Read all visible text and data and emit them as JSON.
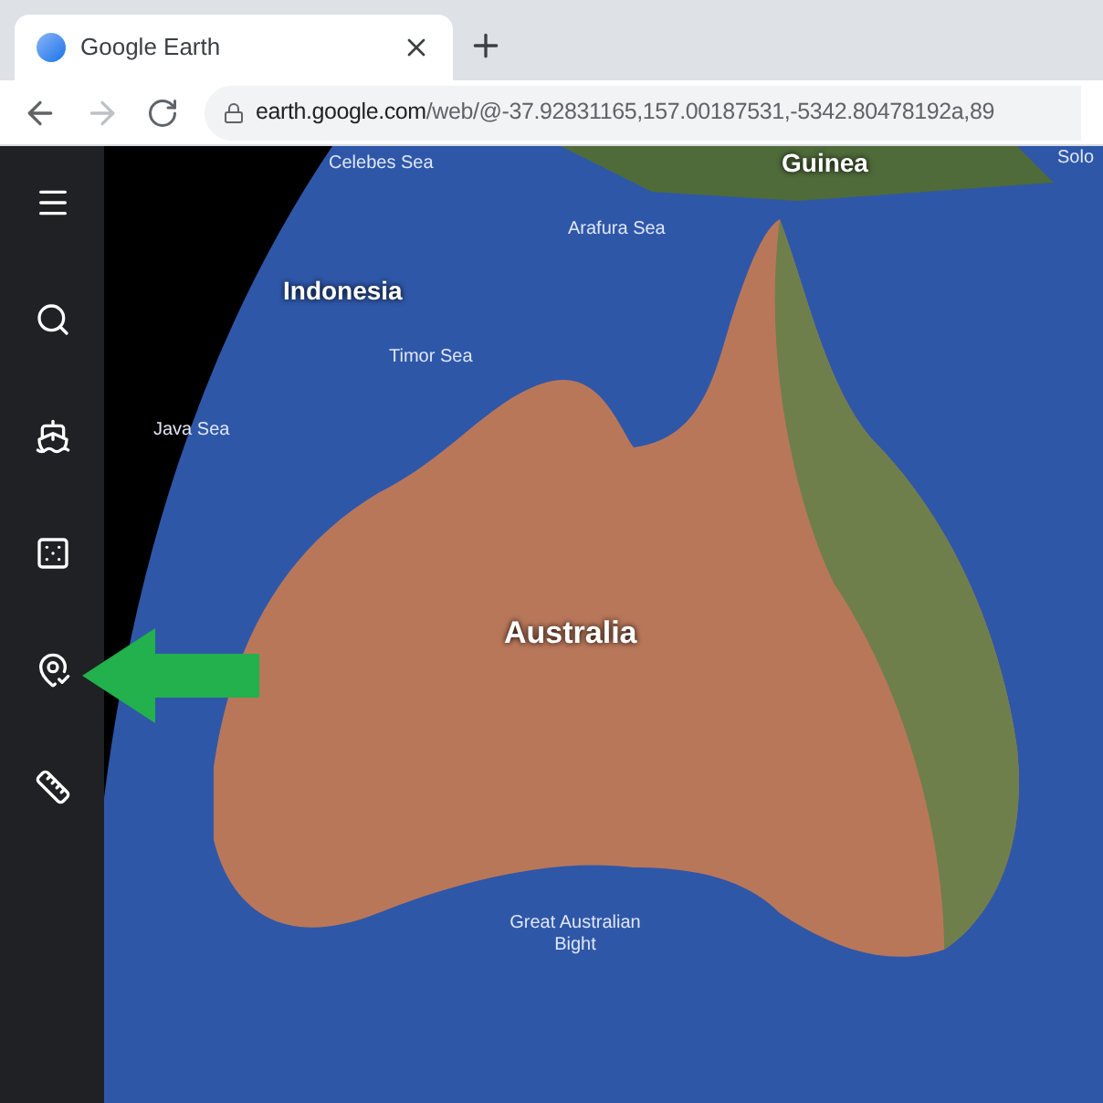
{
  "tab": {
    "title": "Google Earth"
  },
  "address_bar": {
    "host": "earth.google.com",
    "path": "/web/@-37.92831165,157.00187531,-5342.80478192a,89"
  },
  "map_labels": [
    {
      "text": "Celebes Sea",
      "kind": "sea"
    },
    {
      "text": "Guinea",
      "kind": "country"
    },
    {
      "text": "Solo",
      "kind": "sea"
    },
    {
      "text": "Arafura Sea",
      "kind": "sea"
    },
    {
      "text": "Indonesia",
      "kind": "country"
    },
    {
      "text": "Timor Sea",
      "kind": "sea"
    },
    {
      "text": "Java Sea",
      "kind": "sea"
    },
    {
      "text": "Australia",
      "kind": "country"
    },
    {
      "text": "Great Australian Bight",
      "kind": "sea"
    }
  ]
}
